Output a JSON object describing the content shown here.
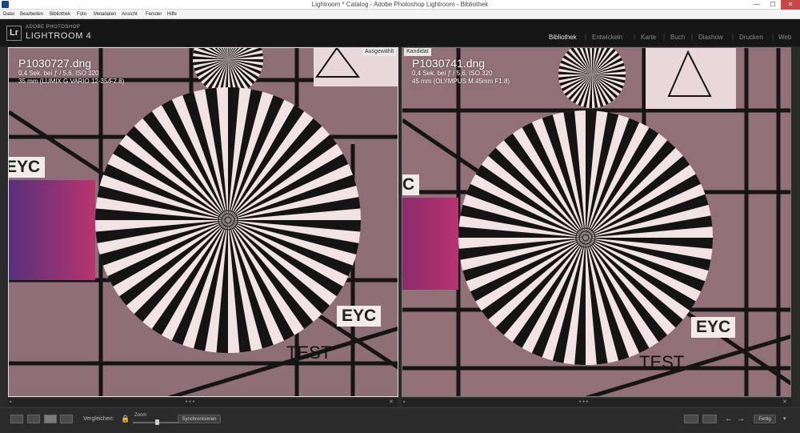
{
  "window": {
    "title": "Lightroom * Catalog - Adobe Photoshop Lightroom - Bibliothek",
    "controls": {
      "minimize": "—",
      "maximize": "☐",
      "close": "✕"
    }
  },
  "menu": [
    "Datei",
    "Bearbeiten",
    "Bibliothek",
    "Foto",
    "Metadaten",
    "Ansicht",
    "Fenster",
    "Hilfe"
  ],
  "brand": {
    "logo": "Lr",
    "adobe": "ADOBE PHOTOSHOP",
    "product": "LIGHTROOM 4"
  },
  "modules": [
    "Bibliothek",
    "Entwickeln",
    "Karte",
    "Buch",
    "Diashow",
    "Drucken",
    "Web"
  ],
  "active_module": "Bibliothek",
  "left": {
    "tag": "Ausgewählt",
    "filename": "P1030727.dng",
    "exposure": "0,4 Sek. bei ƒ / 5,6, ISO 320",
    "lens": "35 mm (LUMIX G VARIO 12-35/F2.8)",
    "labels": {
      "eyc_top": "EYC",
      "eyc_bottom": "EYC",
      "test": "TEST"
    }
  },
  "right": {
    "tag": "Kandidat",
    "filename": "P1030741.dng",
    "exposure": "0,4 Sek. bei ƒ / 5,6, ISO 320",
    "lens": "45 mm (OLYMPUS M.45mm F1.8)",
    "labels": {
      "eyc_top": "C",
      "eyc_bottom": "EYC",
      "test": "TEST"
    }
  },
  "toolbar": {
    "compare_label": "Vergleichen:",
    "zoom_label": "Zoom",
    "sync_button": "Synchronisieren",
    "done_button": "Fertig",
    "zoom_level": 0.5
  },
  "colors": {
    "chart_bg": "#8e6f78",
    "chart_light": "#e9d7d8",
    "accent": "#c4c4c4"
  },
  "icons": [
    "lock-icon",
    "grid-view-icon",
    "loupe-view-icon",
    "compare-view-icon",
    "survey-view-icon",
    "swap-icon",
    "make-select-icon",
    "prev-arrow-icon",
    "next-arrow-icon"
  ]
}
